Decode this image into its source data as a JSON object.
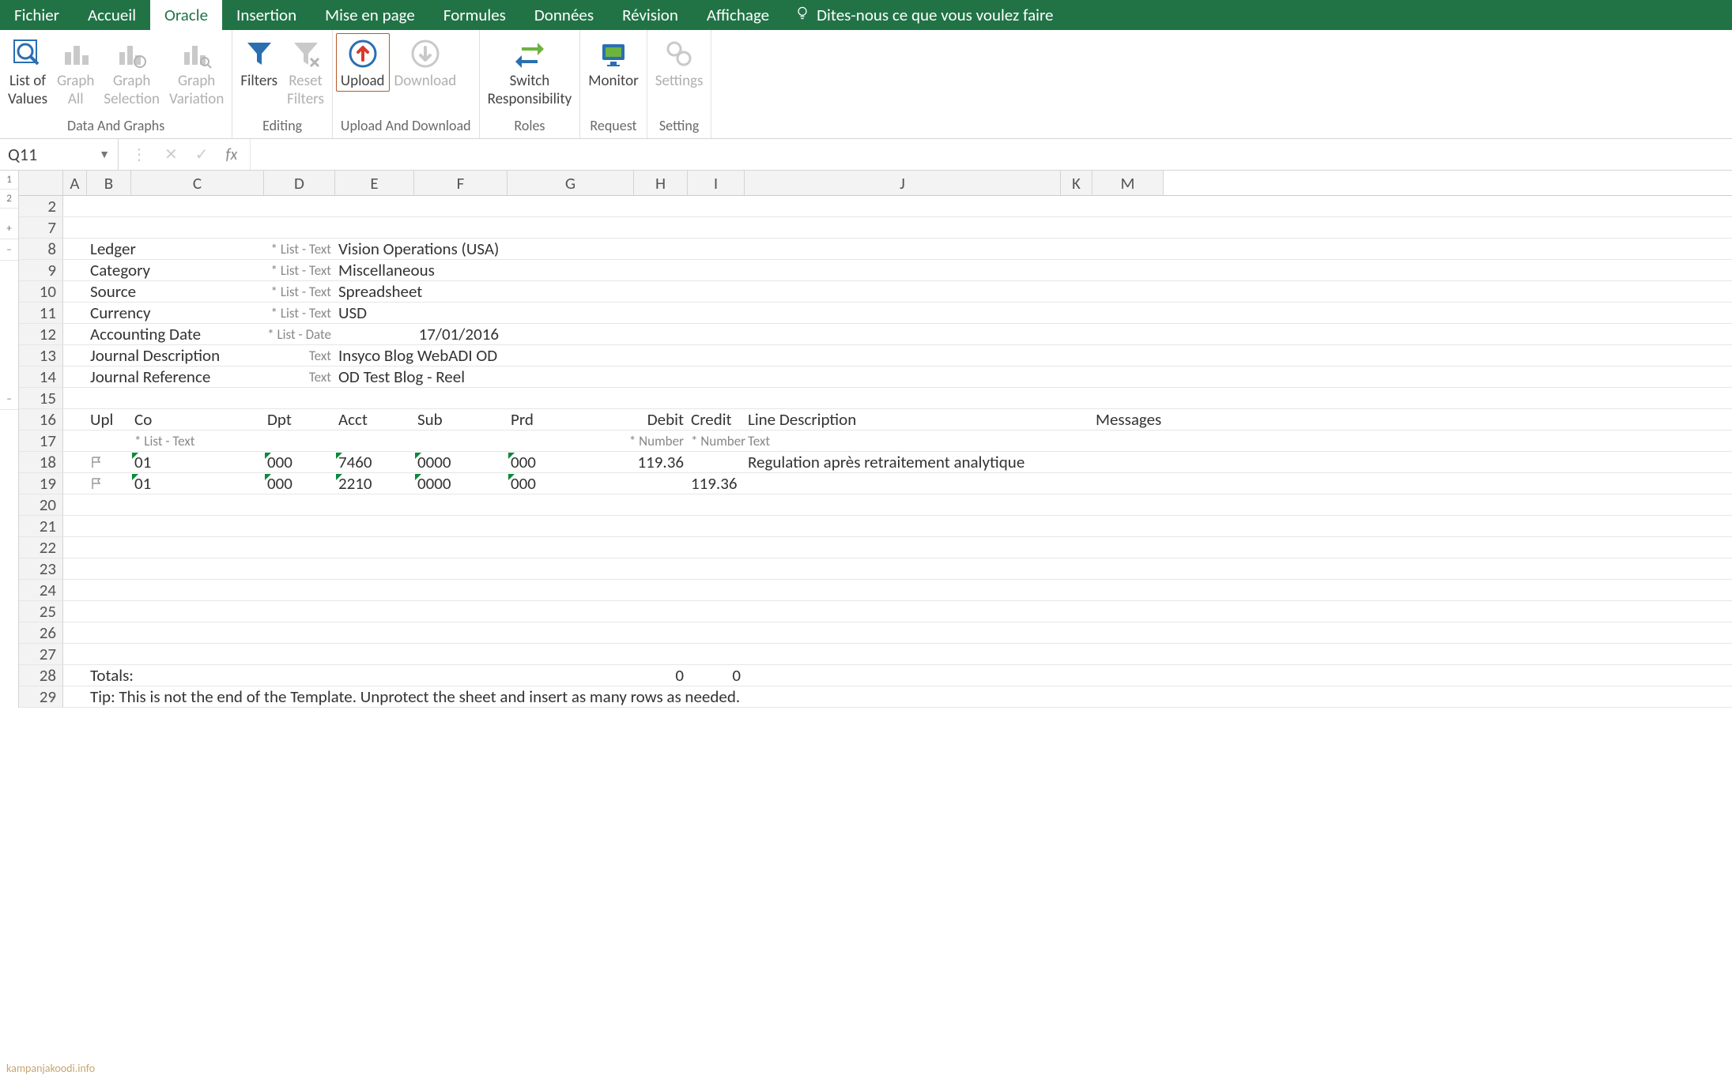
{
  "tabs": {
    "fichier": "Fichier",
    "accueil": "Accueil",
    "oracle": "Oracle",
    "insertion": "Insertion",
    "mise_en_page": "Mise en page",
    "formules": "Formules",
    "donnees": "Données",
    "revision": "Révision",
    "affichage": "Affichage",
    "tellme": "Dites-nous ce que vous voulez faire"
  },
  "ribbon": {
    "data_and_graphs": {
      "label": "Data And Graphs",
      "list_of_values": "List of\nValues",
      "graph_all": "Graph\nAll",
      "graph_selection": "Graph\nSelection",
      "graph_variation": "Graph\nVariation"
    },
    "editing": {
      "label": "Editing",
      "filters": "Filters",
      "reset_filters": "Reset\nFilters"
    },
    "upload_download": {
      "label": "Upload And Download",
      "upload": "Upload",
      "download": "Download"
    },
    "roles": {
      "label": "Roles",
      "switch": "Switch\nResponsibility"
    },
    "request": {
      "label": "Request",
      "monitor": "Monitor"
    },
    "setting": {
      "label": "Setting",
      "settings": "Settings"
    }
  },
  "formula_bar": {
    "namebox": "Q11",
    "fx": "fx"
  },
  "outline": {
    "b1": "1",
    "b2": "2",
    "plus": "+",
    "minus1": "–",
    "minus2": "–"
  },
  "columns": [
    "A",
    "B",
    "C",
    "D",
    "E",
    "F",
    "G",
    "H",
    "I",
    "J",
    "K",
    "M"
  ],
  "row_numbers": [
    "2",
    "7",
    "8",
    "9",
    "10",
    "11",
    "12",
    "13",
    "14",
    "15",
    "16",
    "17",
    "18",
    "19",
    "20",
    "21",
    "22",
    "23",
    "24",
    "25",
    "26",
    "27",
    "28",
    "29"
  ],
  "labels": {
    "ledger": "Ledger",
    "category": "Category",
    "source": "Source",
    "currency": "Currency",
    "accounting_date": "Accounting Date",
    "journal_description": "Journal Description",
    "journal_reference": "Journal Reference",
    "list_text": "* List - Text",
    "list_date": "* List - Date",
    "text": "Text",
    "upl": "Upl",
    "co": "Co",
    "dpt": "Dpt",
    "acct": "Acct",
    "sub": "Sub",
    "prd": "Prd",
    "debit": "Debit",
    "credit": "Credit",
    "line_desc": "Line Description",
    "messages": "Messages",
    "number_hint": "* Number",
    "text_hint": "Text",
    "totals": "Totals:",
    "tip": "Tip: This is not the end of the Template.  Unprotect the sheet and insert as many rows as needed."
  },
  "values": {
    "ledger": "Vision Operations (USA)",
    "category": "Miscellaneous",
    "source": "Spreadsheet",
    "currency": "USD",
    "accounting_date": "17/01/2016",
    "journal_description": "Insyco Blog WebADI OD",
    "journal_reference": "OD Test Blog - Reel"
  },
  "lines": [
    {
      "co": "01",
      "dpt": "000",
      "acct": "7460",
      "sub": "0000",
      "prd": "000",
      "debit": "119.36",
      "credit": "",
      "desc": "Regulation après retraitement analytique"
    },
    {
      "co": "01",
      "dpt": "000",
      "acct": "2210",
      "sub": "0000",
      "prd": "000",
      "debit": "",
      "credit": "119.36",
      "desc": ""
    }
  ],
  "totals": {
    "debit": "0",
    "credit": "0"
  },
  "watermark": "kampanjakoodi.info"
}
